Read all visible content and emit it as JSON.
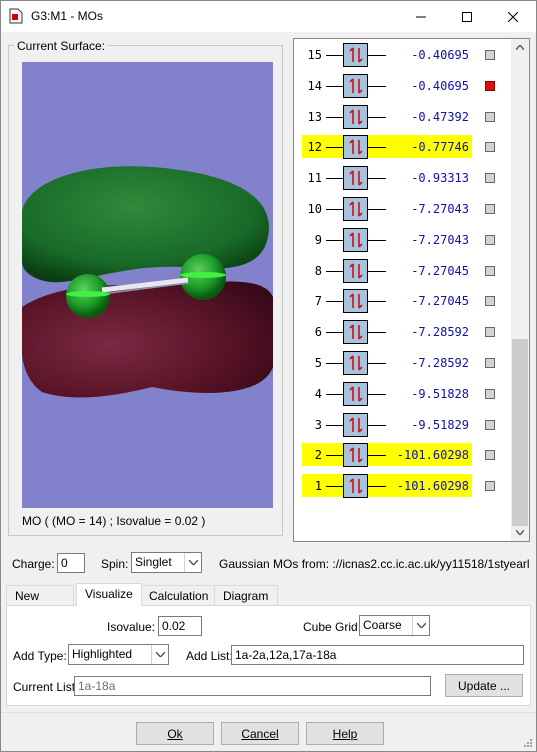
{
  "window": {
    "title": "G3:M1 - MOs"
  },
  "surface": {
    "group_label": "Current Surface:",
    "caption": "MO ( (MO = 14) ; Isovalue = 0.02 )"
  },
  "levels": [
    {
      "n": "15",
      "e": "-0.40695",
      "highlighted": false,
      "selected": false
    },
    {
      "n": "14",
      "e": "-0.40695",
      "highlighted": false,
      "selected": true
    },
    {
      "n": "13",
      "e": "-0.47392",
      "highlighted": false,
      "selected": false
    },
    {
      "n": "12",
      "e": "-0.77746",
      "highlighted": true,
      "selected": false
    },
    {
      "n": "11",
      "e": "-0.93313",
      "highlighted": false,
      "selected": false
    },
    {
      "n": "10",
      "e": "-7.27043",
      "highlighted": false,
      "selected": false
    },
    {
      "n": "9",
      "e": "-7.27043",
      "highlighted": false,
      "selected": false
    },
    {
      "n": "8",
      "e": "-7.27045",
      "highlighted": false,
      "selected": false
    },
    {
      "n": "7",
      "e": "-7.27045",
      "highlighted": false,
      "selected": false
    },
    {
      "n": "6",
      "e": "-7.28592",
      "highlighted": false,
      "selected": false
    },
    {
      "n": "5",
      "e": "-7.28592",
      "highlighted": false,
      "selected": false
    },
    {
      "n": "4",
      "e": "-9.51828",
      "highlighted": false,
      "selected": false
    },
    {
      "n": "3",
      "e": "-9.51829",
      "highlighted": false,
      "selected": false
    },
    {
      "n": "2",
      "e": "-101.60298",
      "highlighted": true,
      "selected": false
    },
    {
      "n": "1",
      "e": "-101.60298",
      "highlighted": true,
      "selected": false
    }
  ],
  "charge": {
    "label": "Charge:",
    "value": "0"
  },
  "spin": {
    "label": "Spin:",
    "value": "Singlet"
  },
  "source": "Gaussian MOs from:  ://icnas2.cc.ic.ac.uk/yy11518/1styearl",
  "tabs": [
    "New MOs",
    "Visualize",
    "Calculation",
    "Diagram"
  ],
  "visualize": {
    "isovalue_label": "Isovalue:",
    "isovalue": "0.02",
    "cube_grid_label": "Cube Grid:",
    "cube_grid": "Coarse",
    "add_type_label": "Add Type:",
    "add_type": "Highlighted",
    "add_list_label": "Add List:",
    "add_list": "1a-2a,12a,17a-18a",
    "current_list_label": "Current List:",
    "current_list": "1a-18a",
    "update_label": "Update ..."
  },
  "footer": {
    "ok": "Ok",
    "cancel": "Cancel",
    "help": "Help"
  },
  "colors": {
    "occupied_box": "#a7c3dd",
    "highlight": "#ffff00",
    "selected_marker": "#e01010",
    "energy_text": "#1010aa",
    "viewport": "#8181cc"
  }
}
